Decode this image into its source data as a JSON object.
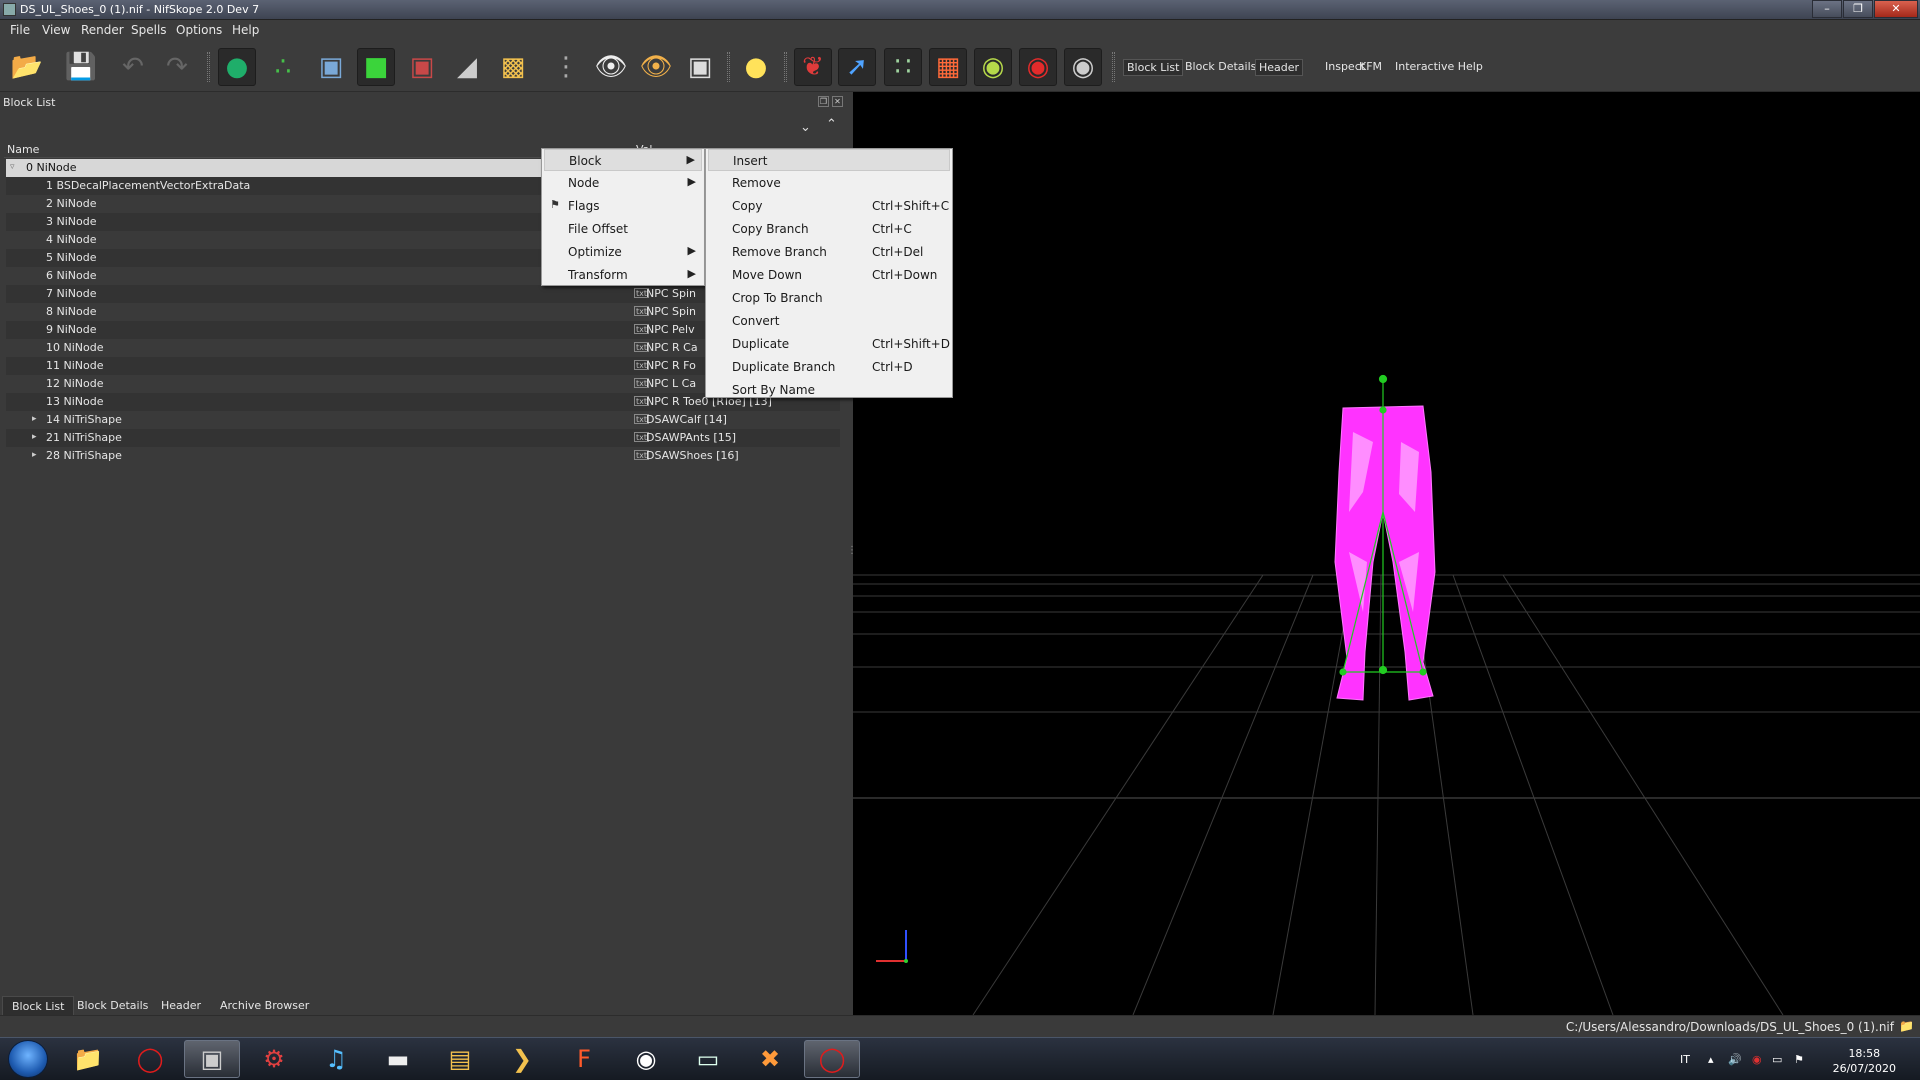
{
  "window": {
    "title": "DS_UL_Shoes_0 (1).nif - NifSkope 2.0 Dev 7"
  },
  "menubar": [
    "File",
    "View",
    "Render",
    "Spells",
    "Options",
    "Help"
  ],
  "toolbar": {
    "icons": [
      "open-file-icon",
      "save-icon",
      "undo-icon",
      "redo-icon",
      "select-object-icon",
      "select-vertex-icon",
      "view-top-icon",
      "view-front-icon",
      "view-side-icon",
      "view-angle-icon",
      "view-walk-icon",
      "show-hidden-icon",
      "show-nodes-icon",
      "show-constraints-icon",
      "screenshot-icon",
      "lighting-icon",
      "pin-icon",
      "axes-icon",
      "skeleton-icon",
      "texture-icon",
      "sphere-icon",
      "marker-icon",
      "eye-icon"
    ],
    "text_buttons": [
      "Block List",
      "Block Details",
      "Header",
      "Inspect",
      "KFM",
      "Interactive Help"
    ],
    "active_text": "Block List"
  },
  "panel": {
    "title": "Block List",
    "col_name": "Name",
    "col_value": "Val"
  },
  "rows": [
    {
      "name": "0 NiNode",
      "value": "",
      "selected": true,
      "expand": "▿",
      "indent": 0
    },
    {
      "name": "1 BSDecalPlacementVectorExtraData",
      "value": "",
      "indent": 1
    },
    {
      "name": "2 NiNode",
      "value": "",
      "indent": 1
    },
    {
      "name": "3 NiNode",
      "value": "",
      "indent": 1
    },
    {
      "name": "4 NiNode",
      "value": "",
      "indent": 1
    },
    {
      "name": "5 NiNode",
      "value": "",
      "indent": 1
    },
    {
      "name": "6 NiNode",
      "value": "",
      "indent": 1
    },
    {
      "name": "7 NiNode",
      "value": "NPC Spin",
      "indent": 1
    },
    {
      "name": "8 NiNode",
      "value": "NPC Spin",
      "indent": 1
    },
    {
      "name": "9 NiNode",
      "value": "NPC Pelv",
      "indent": 1
    },
    {
      "name": "10 NiNode",
      "value": "NPC R Ca",
      "indent": 1
    },
    {
      "name": "11 NiNode",
      "value": "NPC R Fo",
      "indent": 1
    },
    {
      "name": "12 NiNode",
      "value": "NPC L Ca",
      "indent": 1
    },
    {
      "name": "13 NiNode",
      "value": "NPC R Toe0 [RToe] [13]",
      "indent": 1
    },
    {
      "name": "14 NiTriShape",
      "value": "DSAWCalf [14]",
      "expand": "▸",
      "indent": 1
    },
    {
      "name": "21 NiTriShape",
      "value": "DSAWPAnts [15]",
      "expand": "▸",
      "indent": 1
    },
    {
      "name": "28 NiTriShape",
      "value": "DSAWShoes [16]",
      "expand": "▸",
      "indent": 1
    }
  ],
  "context_menu": {
    "items": [
      {
        "label": "Block",
        "submenu": true,
        "highlighted": true
      },
      {
        "label": "Node",
        "submenu": true
      },
      {
        "label": "Flags",
        "icon": "flag-icon"
      },
      {
        "label": "File Offset"
      },
      {
        "label": "Optimize",
        "submenu": true
      },
      {
        "label": "Transform",
        "submenu": true
      }
    ]
  },
  "block_submenu": {
    "items": [
      {
        "label": "Insert",
        "shortcut": "",
        "highlighted": true
      },
      {
        "label": "Remove",
        "shortcut": ""
      },
      {
        "label": "Copy",
        "shortcut": "Ctrl+Shift+C"
      },
      {
        "label": "Copy Branch",
        "shortcut": "Ctrl+C"
      },
      {
        "label": "Remove Branch",
        "shortcut": "Ctrl+Del"
      },
      {
        "label": "Move Down",
        "shortcut": "Ctrl+Down"
      },
      {
        "label": "Crop To Branch",
        "shortcut": ""
      },
      {
        "label": "Convert",
        "shortcut": ""
      },
      {
        "label": "Duplicate",
        "shortcut": "Ctrl+Shift+D"
      },
      {
        "label": "Duplicate Branch",
        "shortcut": "Ctrl+D"
      },
      {
        "label": "Sort By Name",
        "shortcut": ""
      }
    ]
  },
  "bottom_tabs": [
    "Block List",
    "Block Details",
    "Header",
    "Archive Browser"
  ],
  "status": {
    "path": "C:/Users/Alessandro/Downloads/DS_UL_Shoes_0 (1).nif"
  },
  "taskbar": {
    "apps": [
      "explorer-icon",
      "opera-icon",
      "media-center-icon",
      "gear-app-icon",
      "music-icon",
      "audio-editor-icon",
      "notes-icon",
      "arrow-app-icon",
      "flash-icon",
      "ffdec-icon",
      "window-app-icon",
      "puzzle-icon",
      "opera-running-icon"
    ],
    "lang": "IT",
    "time": "18:58",
    "date": "26/07/2020"
  },
  "colors": {
    "model": "#ff33ff",
    "skeleton": "#22cc22",
    "grid": "#3a3a3a"
  }
}
